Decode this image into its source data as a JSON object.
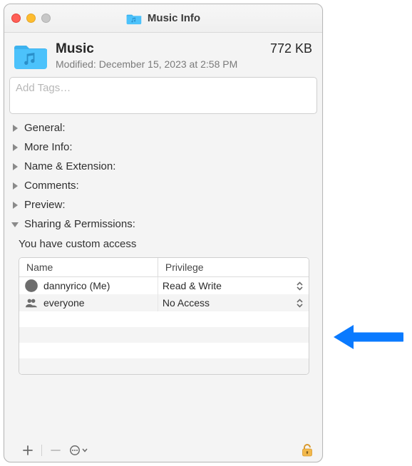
{
  "window": {
    "title": "Music Info"
  },
  "header": {
    "name": "Music",
    "size": "772 KB",
    "modified": "Modified: December 15, 2023 at 2:58 PM"
  },
  "tags": {
    "placeholder": "Add Tags…"
  },
  "sections": {
    "general": "General:",
    "more_info": "More Info:",
    "name_ext": "Name & Extension:",
    "comments": "Comments:",
    "preview": "Preview:",
    "sharing": "Sharing & Permissions:"
  },
  "sharing": {
    "access_text": "You have custom access",
    "columns": {
      "name": "Name",
      "privilege": "Privilege"
    },
    "rows": [
      {
        "icon": "single",
        "name": "dannyrico (Me)",
        "privilege": "Read & Write"
      },
      {
        "icon": "group",
        "name": "everyone",
        "privilege": "No Access"
      }
    ]
  }
}
